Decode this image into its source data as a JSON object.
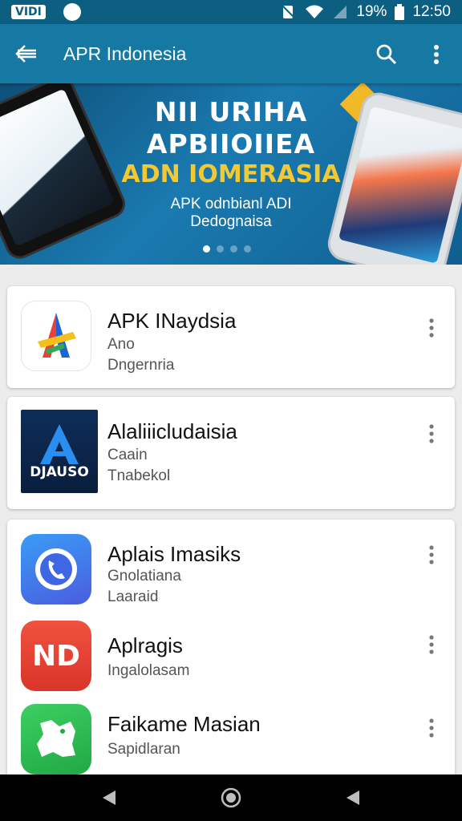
{
  "status_bar": {
    "left_badge": "VIDI",
    "battery": "19%",
    "time": "12:50",
    "icons": [
      "nfc-icon",
      "wifi-icon",
      "signal-icon",
      "battery-icon"
    ]
  },
  "app_bar": {
    "title": "APR Indonesia",
    "icons": [
      "back-arrow-icon",
      "search-icon",
      "more-vert-icon"
    ]
  },
  "banner": {
    "line1": "NII URIHA",
    "line2": "APBIIOIIEA",
    "line3": "ADN IOMERASIA",
    "line4": "APK odnbianl ADI",
    "line5": "Dedognaisa",
    "page_count": 4,
    "active_page": 1
  },
  "apps": [
    {
      "name": "APK INaydsia",
      "line1": "Ano",
      "line2": "Dngernria",
      "icon": "colorful-a-logo-icon"
    },
    {
      "name": "Alaliiicludaisia",
      "line1": "Caain",
      "line2": "Tnabekol",
      "icon": "djauso-a-logo-icon",
      "icon_label": "DJAUSO"
    },
    {
      "name": "Aplais Imasiks",
      "line1": "Gnolatiana",
      "line2": "Laaraid",
      "icon": "phone-call-icon"
    },
    {
      "name": "Aplragis",
      "line1": "Ingalolasam",
      "line2": "",
      "icon": "nd-logo-icon",
      "icon_label": "ND"
    },
    {
      "name": "Faikame Masian",
      "line1": "Sapidlaran",
      "line2": "",
      "icon": "map-icon"
    }
  ],
  "nav_bar": {
    "icons": [
      "back-triangle-icon",
      "home-circle-icon",
      "recents-triangle-icon"
    ]
  },
  "colors": {
    "status_bar": "#0c5f80",
    "app_bar": "#1579a3",
    "banner_accent": "#f3c933",
    "background": "#ececec"
  }
}
